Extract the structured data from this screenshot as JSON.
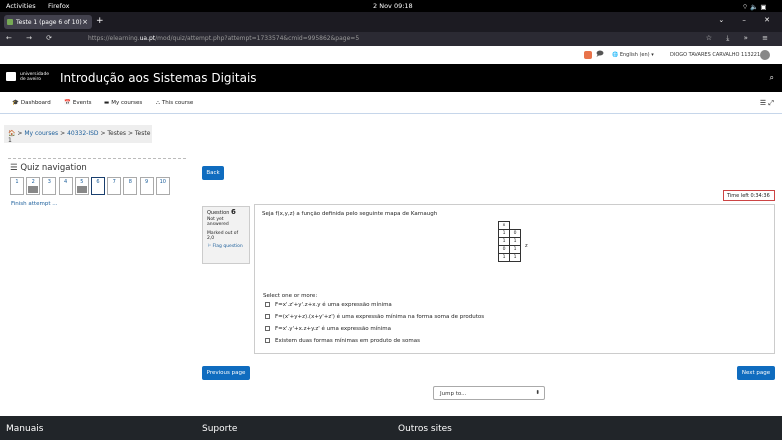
{
  "gnome": {
    "activities": "Activities",
    "app": "Firefox",
    "clock": "2 Nov  09:18",
    "tray": "⌔ 🔈 ▣"
  },
  "browser": {
    "tab_title": "Teste 1 (page 6 of 10)",
    "tab_close": "×",
    "new_tab": "+",
    "win_controls": "⌄ – ✕",
    "nav": "← → ⟳",
    "url_prefix": "https://elearning.",
    "url_domain": "ua.pt",
    "url_rest": "/mod/quiz/attempt.php?attempt=1733574&cmid=995862&page=5",
    "right_icons": "☆ ⤓ » ≡"
  },
  "userbar": {
    "chat": "🗩",
    "language": "🌐 English (en) ▾",
    "user_name": "DIOGO TAVARES CARVALHO 113221"
  },
  "header": {
    "uni_line1": "universidade",
    "uni_line2": "de aveiro",
    "course_title": "Introdução aos Sistemas Digitais",
    "search": "⌕"
  },
  "menu": {
    "items": [
      {
        "icon": "🎓",
        "label": "Dashboard"
      },
      {
        "icon": "📅",
        "label": "Events"
      },
      {
        "icon": "▬",
        "label": "My courses"
      },
      {
        "icon": "⛬",
        "label": "This course"
      }
    ],
    "right": "☰ ⤢"
  },
  "breadcrumb": {
    "home": "🏠",
    "sep": ">",
    "items": [
      "My courses",
      "40332-ISD",
      "Testes",
      "Teste 1"
    ]
  },
  "quiz_nav": {
    "title": "☰ Quiz navigation",
    "buttons": [
      {
        "n": "1",
        "answered": false
      },
      {
        "n": "2",
        "answered": true
      },
      {
        "n": "3",
        "answered": false
      },
      {
        "n": "4",
        "answered": false
      },
      {
        "n": "5",
        "answered": true
      },
      {
        "n": "6",
        "answered": false,
        "current": true
      },
      {
        "n": "7",
        "answered": false
      },
      {
        "n": "8",
        "answered": false
      },
      {
        "n": "9",
        "answered": false
      },
      {
        "n": "10",
        "answered": false
      }
    ],
    "finish": "Finish attempt ..."
  },
  "back": "Back",
  "timer": "Time left 0:34:36",
  "question": {
    "label": "Question",
    "number": "6",
    "status_l1": "Not yet",
    "status_l2": "answered",
    "marked_l1": "Marked out of",
    "marked_l2": "2,0",
    "flag": "⚐ Flag question",
    "text": "Seja f(x,y,z) a função definida pelo seguinte mapa de Karnaugh",
    "kmap": {
      "header": "x",
      "rows": [
        [
          "1",
          "0"
        ],
        [
          "1",
          "1"
        ],
        [
          "0",
          "1"
        ],
        [
          "1",
          "1"
        ]
      ],
      "z_label": "z"
    },
    "select": "Select one or more:",
    "options": [
      "F=x'.z'+y'.z+x.y é uma expressão mínima",
      "F=(x'+y+z).(x+y'+z') é uma expressão mínima na forma soma de produtos",
      "F=x'.y'+x.z+y.z' é uma expressão mínima",
      "Existem duas formas mínimas em produto de somas"
    ]
  },
  "prev": "Previous page",
  "next": "Next page",
  "jump": {
    "label": "Jump to...",
    "chev": "⬍"
  },
  "footer": {
    "col1": "Manuais",
    "col2": "Suporte",
    "col3": "Outros sites"
  }
}
